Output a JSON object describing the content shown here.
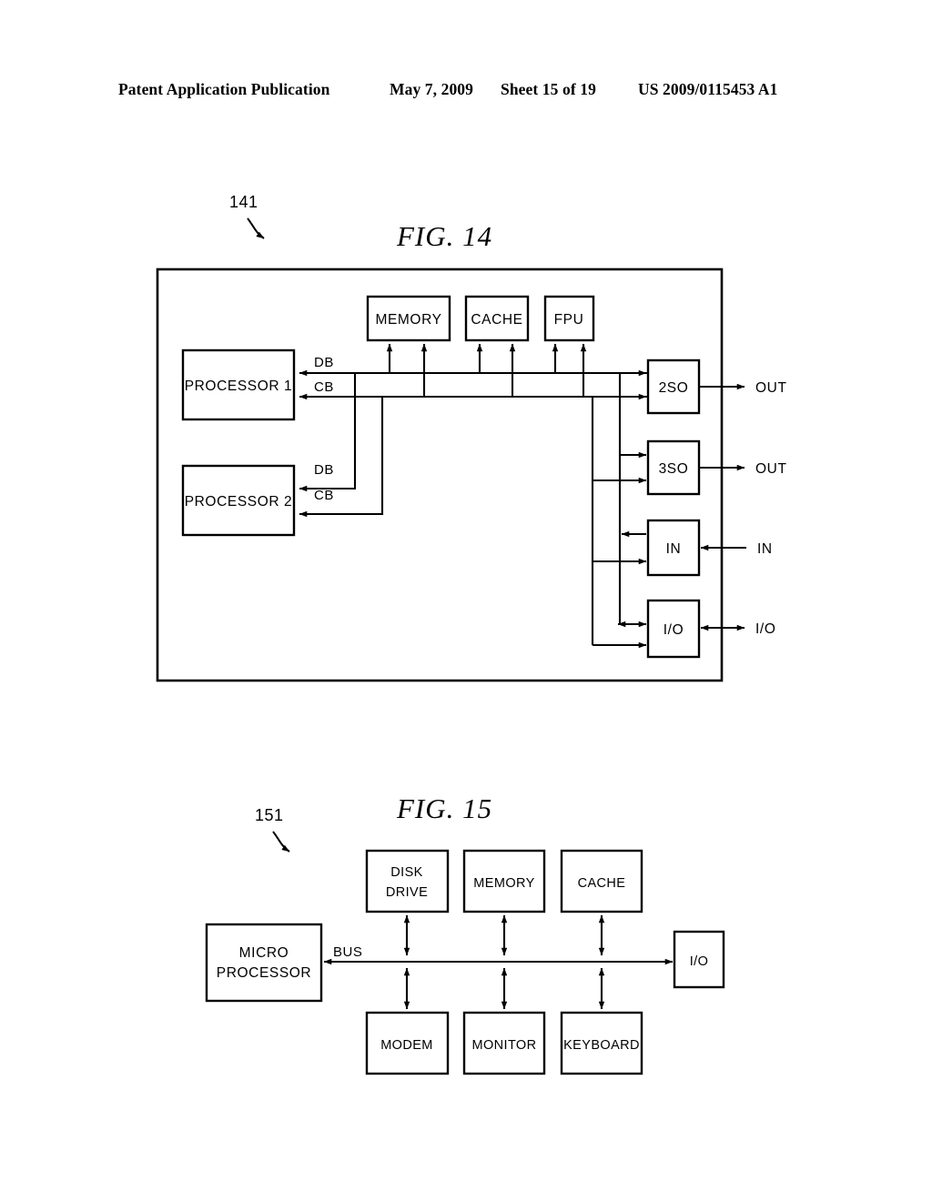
{
  "header": {
    "publication": "Patent Application Publication",
    "date": "May 7, 2009",
    "sheet": "Sheet 15 of 19",
    "patent_number": "US 2009/0115453 A1"
  },
  "figures": [
    {
      "caption": "FIG.  14",
      "reference_numeral": "141",
      "blocks": {
        "memory": "MEMORY",
        "cache": "CACHE",
        "fpu": "FPU",
        "processor1": "PROCESSOR  1",
        "processor2": "PROCESSOR  2",
        "two_state_out": "2SO",
        "three_state_out": "3SO",
        "input": "IN",
        "inout": "I/O"
      },
      "bus_labels": {
        "p1_db": "DB",
        "p1_cb": "CB",
        "p2_db": "DB",
        "p2_cb": "CB"
      },
      "port_labels": {
        "out_1": "OUT",
        "out_2": "OUT",
        "in_1": "IN",
        "io_1": "I/O"
      }
    },
    {
      "caption": "FIG.  15",
      "reference_numeral": "151",
      "blocks": {
        "microprocessor_line1": "MICRO",
        "microprocessor_line2": "PROCESSOR",
        "disk_drive_line1": "DISK",
        "disk_drive_line2": "DRIVE",
        "memory": "MEMORY",
        "cache": "CACHE",
        "modem": "MODEM",
        "monitor": "MONITOR",
        "keyboard": "KEYBOARD",
        "io": "I/O"
      },
      "bus_labels": {
        "bus": "BUS"
      }
    }
  ],
  "colors": {
    "ink": "#000000",
    "paper": "#ffffff"
  }
}
